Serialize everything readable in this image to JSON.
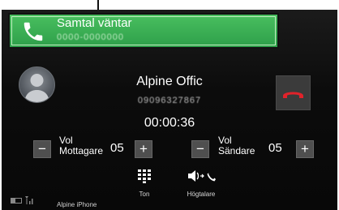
{
  "incoming_call": {
    "title": "Samtal väntar",
    "number": "0000-0000000"
  },
  "active_call": {
    "name": "Alpine Offic",
    "number": "09096327867",
    "duration": "00:00:36"
  },
  "receiver_volume": {
    "label_line1": "Vol",
    "label_line2": "Mottagare",
    "value": "05",
    "minus": "−",
    "plus": "+"
  },
  "sender_volume": {
    "label_line1": "Vol",
    "label_line2": "Sändare",
    "value": "05",
    "minus": "−",
    "plus": "+"
  },
  "actions": {
    "tone_label": "Ton",
    "speaker_label": "Högtalare"
  },
  "status_bar": {
    "device_name": "Alpine iPhone"
  },
  "colors": {
    "banner_green": "#3daf55",
    "end_call_red": "#e0222a"
  }
}
